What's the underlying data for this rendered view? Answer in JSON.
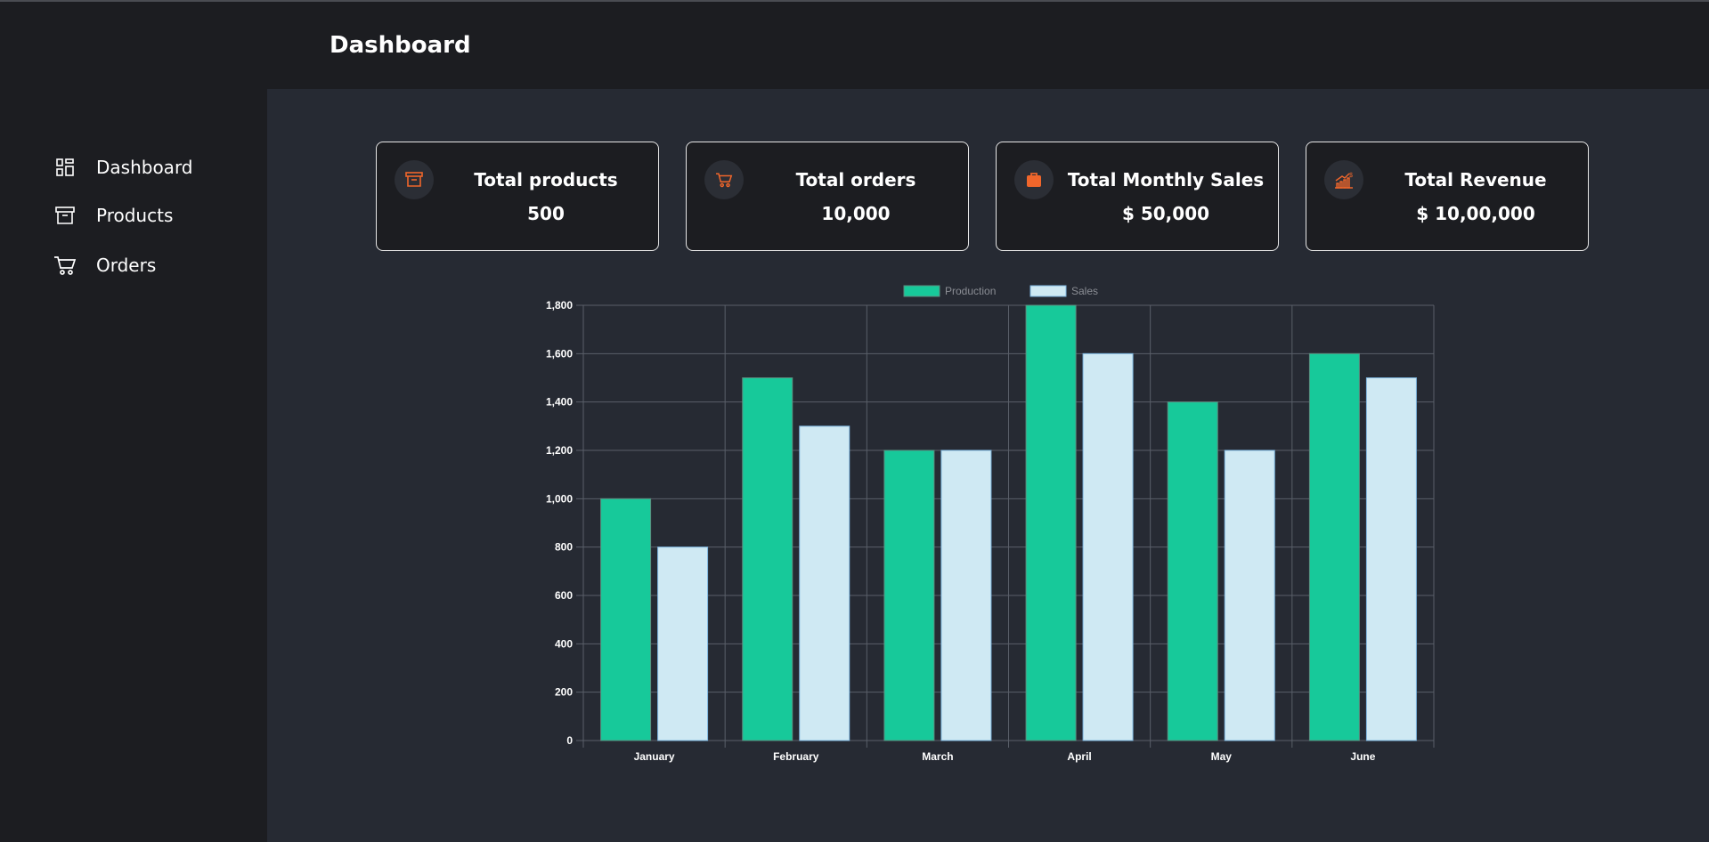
{
  "header": {
    "title": "Dashboard"
  },
  "sidebar": {
    "items": [
      {
        "label": "Dashboard",
        "icon": "dashboard-icon"
      },
      {
        "label": "Products",
        "icon": "archive-box-icon"
      },
      {
        "label": "Orders",
        "icon": "cart-icon"
      }
    ]
  },
  "cards": [
    {
      "title": "Total products",
      "value": "500",
      "icon": "archive-box-icon"
    },
    {
      "title": "Total orders",
      "value": "10,000",
      "icon": "cart-icon"
    },
    {
      "title": "Total Monthly Sales",
      "value": "$ 50,000",
      "icon": "shopping-bag-icon"
    },
    {
      "title": "Total Revenue",
      "value": "$ 10,00,000",
      "icon": "revenue-growth-icon"
    }
  ],
  "colors": {
    "accent": "#f0662b",
    "production": "#17c99a",
    "sales": "#cfe9f3",
    "grid": "#5a5f69"
  },
  "chart_data": {
    "type": "bar",
    "categories": [
      "January",
      "February",
      "March",
      "April",
      "May",
      "June"
    ],
    "series": [
      {
        "name": "Production",
        "values": [
          1000,
          1500,
          1200,
          1800,
          1400,
          1600
        ]
      },
      {
        "name": "Sales",
        "values": [
          800,
          1300,
          1200,
          1600,
          1200,
          1500
        ]
      }
    ],
    "yticks": [
      "0",
      "200",
      "400",
      "600",
      "800",
      "1,000",
      "1,200",
      "1,400",
      "1,600",
      "1,800"
    ],
    "ylim": [
      0,
      1800
    ],
    "grid": true,
    "legend": "top"
  }
}
